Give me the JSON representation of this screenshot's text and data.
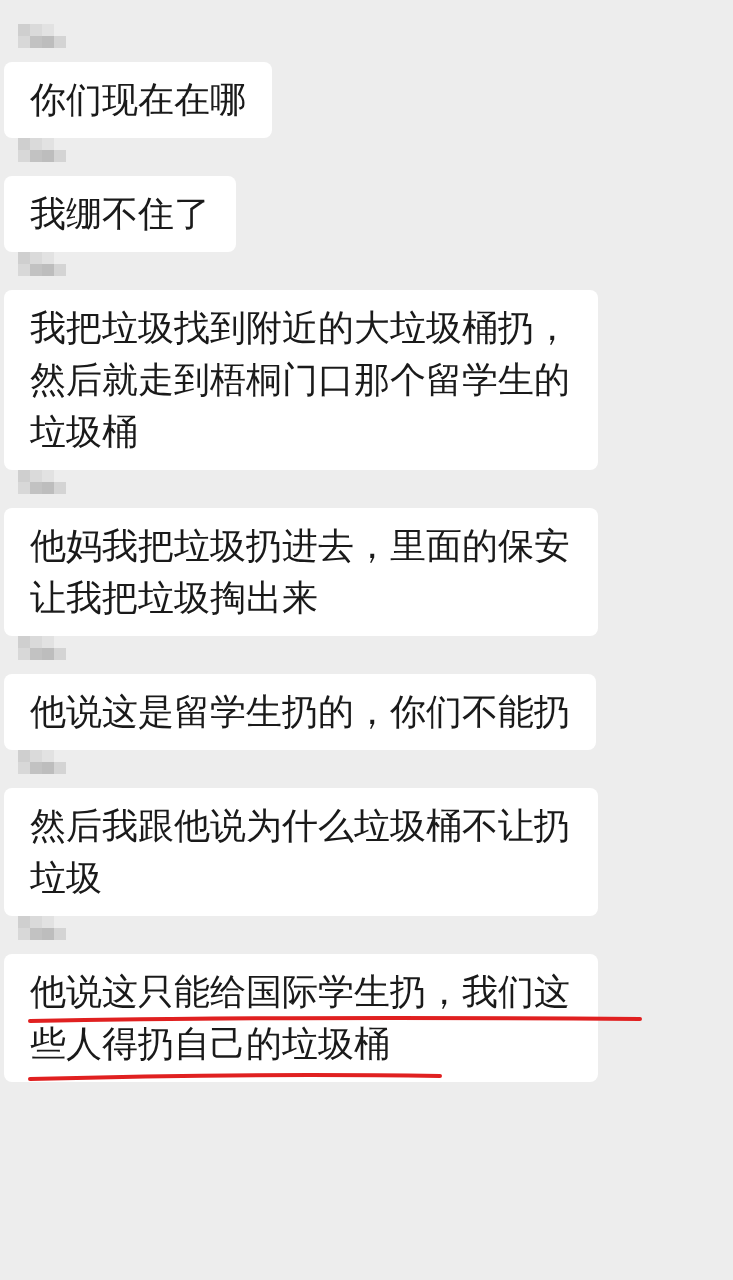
{
  "messages": [
    {
      "text": "你们现在在哪",
      "underlined": false
    },
    {
      "text": "我绷不住了",
      "underlined": false
    },
    {
      "text": "我把垃圾找到附近的大垃圾桶扔，然后就走到梧桐门口那个留学生的垃圾桶",
      "underlined": false
    },
    {
      "text": "他妈我把垃圾扔进去，里面的保安让我把垃圾掏出来",
      "underlined": false
    },
    {
      "text": "他说这是留学生扔的，你们不能扔",
      "underlined": false
    },
    {
      "text": "然后我跟他说为什么垃圾桶不让扔垃圾",
      "underlined": false
    },
    {
      "text": "他说这只能给国际学生扔，我们这些人得扔自己的垃圾桶",
      "underlined": true
    }
  ]
}
